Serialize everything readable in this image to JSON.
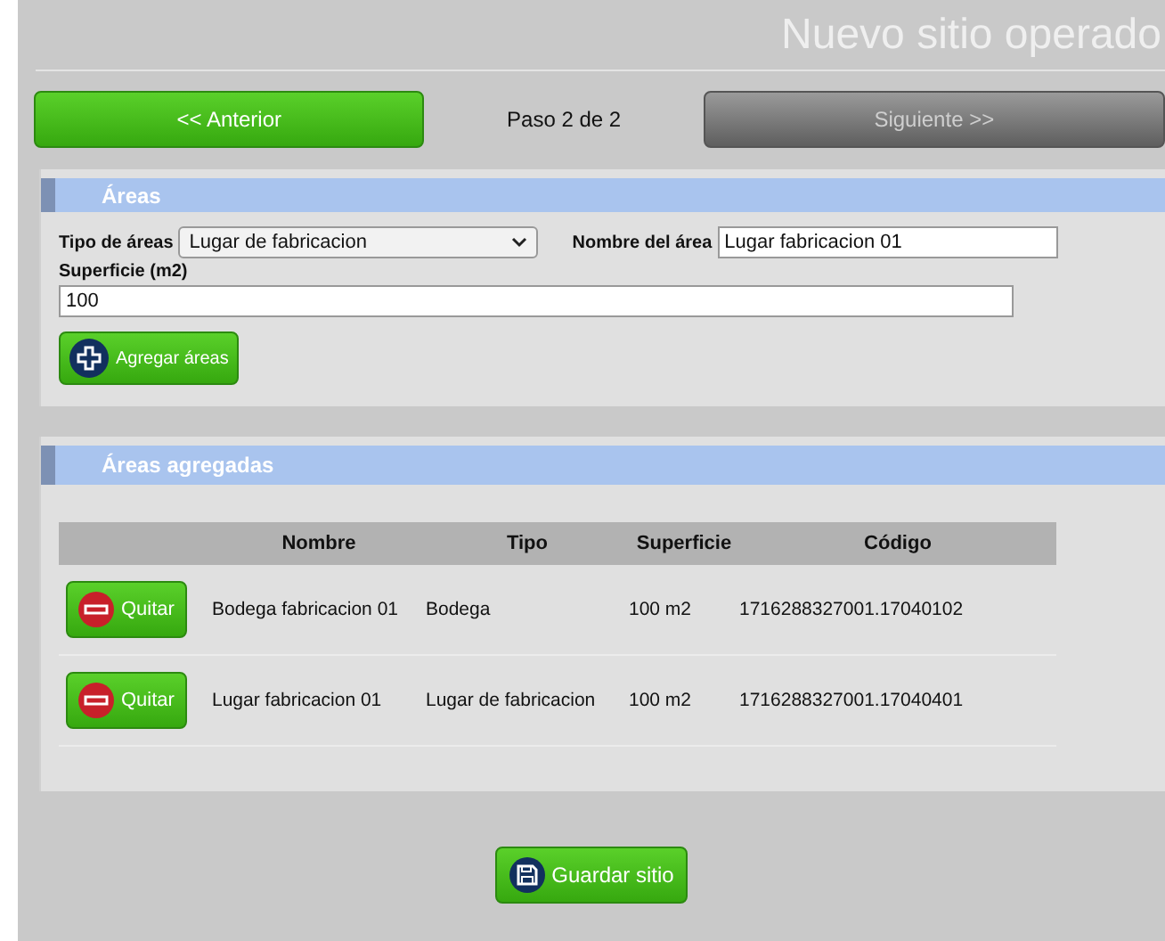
{
  "title": "Nuevo sitio operado",
  "nav": {
    "previous": {
      "label": "<< Anterior",
      "disabled": false
    },
    "step": "Paso 2 de 2",
    "next": {
      "label": "Siguiente >>",
      "disabled": true
    }
  },
  "areas_form": {
    "heading": "Áreas",
    "type_label": "Tipo de áreas",
    "type_value": "Lugar de fabricacion",
    "name_label": "Nombre del área",
    "name_value": "Lugar fabricacion 01",
    "surface_label": "Superficie (m2)",
    "surface_value": "100",
    "add_button": "Agregar áreas"
  },
  "added_areas": {
    "heading": "Áreas agregadas",
    "columns": [
      "Nombre",
      "Tipo",
      "Superficie",
      "Código"
    ],
    "rows": [
      {
        "action": "Quitar",
        "name": "Bodega fabricacion 01",
        "type": "Bodega",
        "surface": "100 m2",
        "code": "1716288327001.17040102"
      },
      {
        "action": "Quitar",
        "name": "Lugar fabricacion 01",
        "type": "Lugar de fabricacion",
        "surface": "100 m2",
        "code": "1716288327001.17040401"
      }
    ]
  },
  "save_button": "Guardar sitio"
}
